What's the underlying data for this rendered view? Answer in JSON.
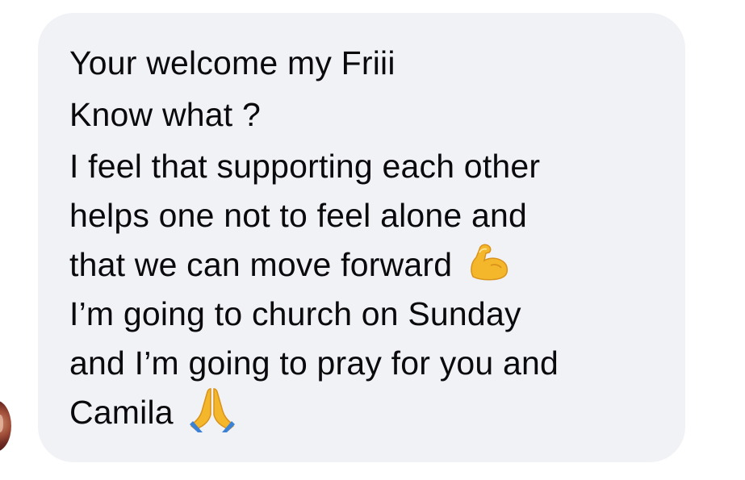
{
  "message": {
    "lines": [
      "Your welcome my Friii",
      "Know what ?",
      "I feel that supporting each other",
      "helps one not to feel alone and",
      "that we can move forward",
      "I’m going to church on Sunday",
      "and I’m going to pray for you and",
      "Camila"
    ],
    "emojis": {
      "line5": "flexed-biceps-emoji",
      "line8": "folded-hands-emoji"
    }
  },
  "colors": {
    "bubble_background": "#f1f2f6",
    "text": "#0a0a0c",
    "emoji_yellow": "#f4b62a"
  }
}
